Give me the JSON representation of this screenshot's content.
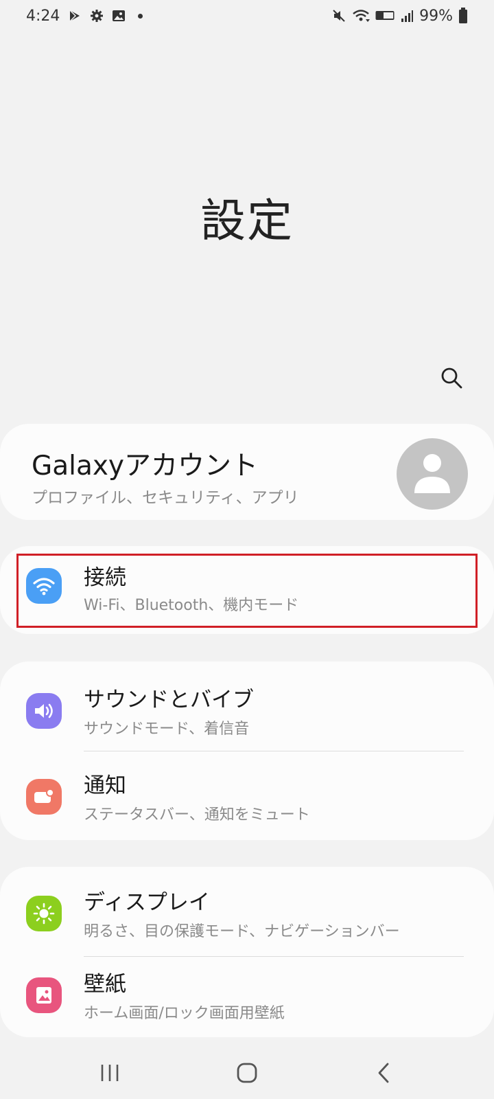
{
  "status_bar": {
    "time": "4:24",
    "battery": "99%",
    "left_icons": [
      "play-store-icon",
      "gear-icon",
      "image-icon",
      "dot-icon"
    ],
    "right_icons": [
      "mute-icon",
      "wifi-icon",
      "volte-icon",
      "signal-icon",
      "battery-icon"
    ]
  },
  "header": {
    "title": "設定"
  },
  "account": {
    "title": "Galaxyアカウント",
    "subtitle": "プロファイル、セキュリティ、アプリ"
  },
  "menu": {
    "connections": {
      "title": "接続",
      "subtitle": "Wi-Fi、Bluetooth、機内モード",
      "icon_color": "#4a9ff5"
    },
    "sound": {
      "title": "サウンドとバイブ",
      "subtitle": "サウンドモード、着信音",
      "icon_color": "#8a7cf0"
    },
    "notifications": {
      "title": "通知",
      "subtitle": "ステータスバー、通知をミュート",
      "icon_color": "#f07866"
    },
    "display": {
      "title": "ディスプレイ",
      "subtitle": "明るさ、目の保護モード、ナビゲーションバー",
      "icon_color": "#8ccf1e"
    },
    "wallpaper": {
      "title": "壁紙",
      "subtitle": "ホーム画面/ロック画面用壁紙",
      "icon_color": "#e8557e"
    }
  },
  "highlight_color": "#d01f26",
  "nav_bar": {
    "icons": [
      "recent-apps-icon",
      "home-icon",
      "back-icon"
    ]
  }
}
